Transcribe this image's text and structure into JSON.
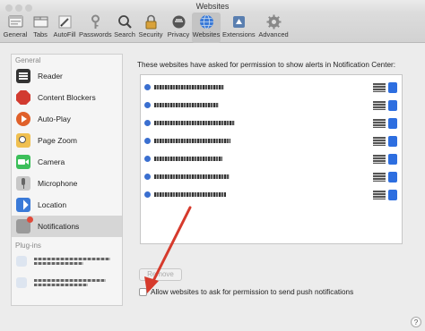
{
  "window": {
    "title": "Websites"
  },
  "toolbar": {
    "items": [
      {
        "label": "General",
        "icon": "general-icon"
      },
      {
        "label": "Tabs",
        "icon": "tabs-icon"
      },
      {
        "label": "AutoFill",
        "icon": "autofill-icon"
      },
      {
        "label": "Passwords",
        "icon": "key-icon"
      },
      {
        "label": "Search",
        "icon": "search-icon"
      },
      {
        "label": "Security",
        "icon": "lock-icon"
      },
      {
        "label": "Privacy",
        "icon": "privacy-icon"
      },
      {
        "label": "Websites",
        "icon": "globe-icon",
        "active": true
      },
      {
        "label": "Extensions",
        "icon": "extensions-icon"
      },
      {
        "label": "Advanced",
        "icon": "gear-icon"
      }
    ]
  },
  "sidebar": {
    "general_header": "General",
    "items": [
      {
        "label": "Reader",
        "icon": "reader-icon"
      },
      {
        "label": "Content Blockers",
        "icon": "stop-icon"
      },
      {
        "label": "Auto-Play",
        "icon": "play-icon"
      },
      {
        "label": "Page Zoom",
        "icon": "zoom-icon"
      },
      {
        "label": "Camera",
        "icon": "camera-icon"
      },
      {
        "label": "Microphone",
        "icon": "microphone-icon"
      },
      {
        "label": "Location",
        "icon": "location-icon"
      },
      {
        "label": "Notifications",
        "icon": "notifications-icon",
        "selected": true
      }
    ],
    "plugins_header": "Plug-ins"
  },
  "panel": {
    "description": "These websites have asked for permission to show alerts in Notification Center:",
    "remove_label": "Remove",
    "checkbox_label": "Allow websites to ask for permission to send push notifications",
    "checkbox_checked": false
  },
  "colors": {
    "accent": "#2d6ee0",
    "arrow": "#d63a2c"
  }
}
